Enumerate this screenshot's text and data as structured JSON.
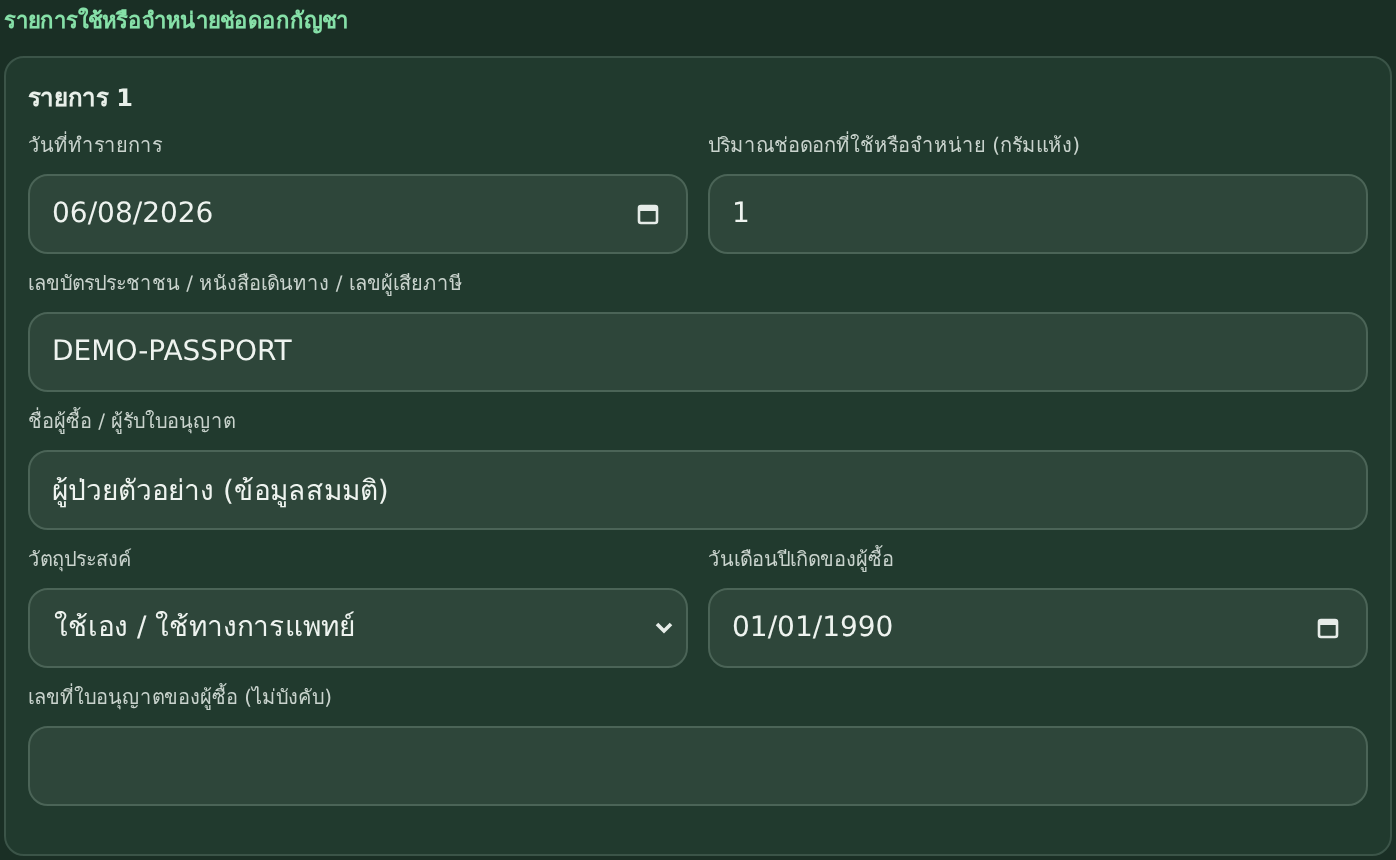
{
  "section_title": "รายการใช้หรือจำหน่ายช่อดอกกัญชา",
  "card": {
    "title": "รายการ 1",
    "rows": [
      [
        {
          "label": "วันที่ทำรายการ",
          "kind": "date",
          "value": "06/08/2026"
        },
        {
          "label": "ปริมาณช่อดอกที่ใช้หรือจำหน่าย (กรัมแห้ง)",
          "kind": "number",
          "value": "1"
        }
      ],
      [
        {
          "label": "เลขบัตรประชาชน / หนังสือเดินทาง / เลขผู้เสียภาษี",
          "kind": "text",
          "value": "DEMO-PASSPORT"
        }
      ],
      [
        {
          "label": "ชื่อผู้ซื้อ / ผู้รับใบอนุญาต",
          "kind": "text",
          "value": "ผู้ป่วยตัวอย่าง (ข้อมูลสมมติ)"
        }
      ],
      [
        {
          "label": "วัตถุประสงค์",
          "kind": "select",
          "value": "ใช้เอง / ใช้ทางการแพทย์"
        },
        {
          "label": "วันเดือนปีเกิดของผู้ซื้อ",
          "kind": "date",
          "value": "01/01/1990"
        }
      ],
      [
        {
          "label": "เลขที่ใบอนุญาตของผู้ซื้อ (ไม่บังคับ)",
          "kind": "text"
        }
      ]
    ]
  }
}
